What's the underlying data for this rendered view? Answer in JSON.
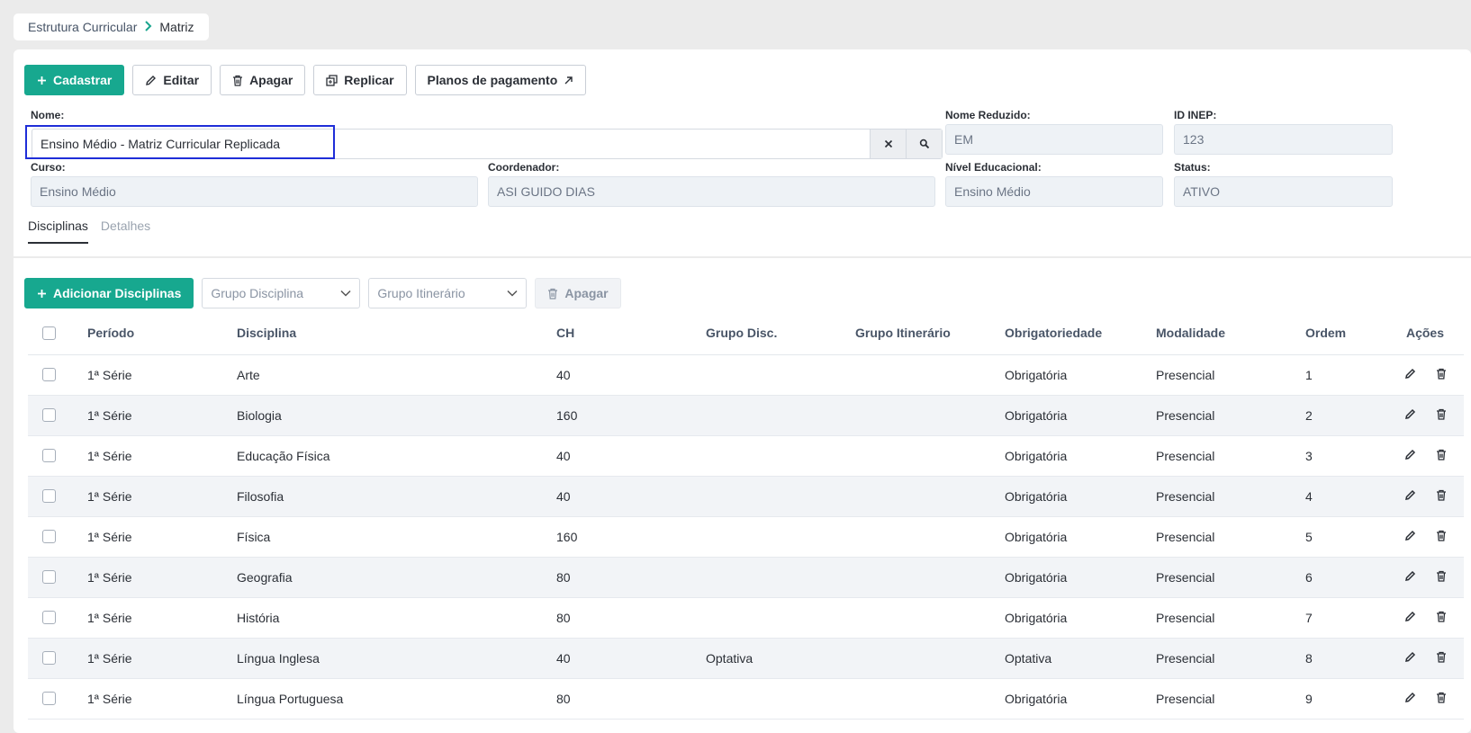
{
  "breadcrumb": {
    "parent": "Estrutura Curricular",
    "separator": ">",
    "current": "Matriz"
  },
  "toolbar": {
    "cadastrar": "Cadastrar",
    "editar": "Editar",
    "apagar": "Apagar",
    "replicar": "Replicar",
    "planos": "Planos de pagamento"
  },
  "form": {
    "nome_label": "Nome:",
    "nome_value": "Ensino Médio - Matriz Curricular Replicada",
    "nome_reduzido_label": "Nome Reduzido:",
    "nome_reduzido_value": "EM",
    "id_inep_label": "ID INEP:",
    "id_inep_value": "123",
    "curso_label": "Curso:",
    "curso_value": "Ensino Médio",
    "coordenador_label": "Coordenador:",
    "coordenador_value": "ASI GUIDO DIAS",
    "nivel_label": "Nível Educacional:",
    "nivel_value": "Ensino Médio",
    "status_label": "Status:",
    "status_value": "ATIVO"
  },
  "tabs": [
    {
      "label": "Disciplinas"
    },
    {
      "label": "Detalhes"
    }
  ],
  "subtoolbar": {
    "adicionar": "Adicionar Disciplinas",
    "grupo_disciplina_placeholder": "Grupo Disciplina",
    "grupo_itinerario_placeholder": "Grupo Itinerário",
    "apagar": "Apagar"
  },
  "table": {
    "headers": [
      "Período",
      "Disciplina",
      "CH",
      "Grupo Disc.",
      "Grupo Itinerário",
      "Obrigatoriedade",
      "Modalidade",
      "Ordem",
      "Ações"
    ],
    "rows": [
      {
        "periodo": "1ª Série",
        "disciplina": "Arte",
        "ch": "40",
        "grupo_disc": "",
        "grupo_itin": "",
        "obrig": "Obrigatória",
        "modal": "Presencial",
        "ordem": "1"
      },
      {
        "periodo": "1ª Série",
        "disciplina": "Biologia",
        "ch": "160",
        "grupo_disc": "",
        "grupo_itin": "",
        "obrig": "Obrigatória",
        "modal": "Presencial",
        "ordem": "2"
      },
      {
        "periodo": "1ª Série",
        "disciplina": "Educação Física",
        "ch": "40",
        "grupo_disc": "",
        "grupo_itin": "",
        "obrig": "Obrigatória",
        "modal": "Presencial",
        "ordem": "3"
      },
      {
        "periodo": "1ª Série",
        "disciplina": "Filosofia",
        "ch": "40",
        "grupo_disc": "",
        "grupo_itin": "",
        "obrig": "Obrigatória",
        "modal": "Presencial",
        "ordem": "4"
      },
      {
        "periodo": "1ª Série",
        "disciplina": "Física",
        "ch": "160",
        "grupo_disc": "",
        "grupo_itin": "",
        "obrig": "Obrigatória",
        "modal": "Presencial",
        "ordem": "5"
      },
      {
        "periodo": "1ª Série",
        "disciplina": "Geografia",
        "ch": "80",
        "grupo_disc": "",
        "grupo_itin": "",
        "obrig": "Obrigatória",
        "modal": "Presencial",
        "ordem": "6"
      },
      {
        "periodo": "1ª Série",
        "disciplina": "História",
        "ch": "80",
        "grupo_disc": "",
        "grupo_itin": "",
        "obrig": "Obrigatória",
        "modal": "Presencial",
        "ordem": "7"
      },
      {
        "periodo": "1ª Série",
        "disciplina": "Língua Inglesa",
        "ch": "40",
        "grupo_disc": "Optativa",
        "grupo_itin": "",
        "obrig": "Optativa",
        "modal": "Presencial",
        "ordem": "8"
      },
      {
        "periodo": "1ª Série",
        "disciplina": "Língua Portuguesa",
        "ch": "80",
        "grupo_disc": "",
        "grupo_itin": "",
        "obrig": "Obrigatória",
        "modal": "Presencial",
        "ordem": "9"
      }
    ]
  },
  "colors": {
    "accent": "#17a88f",
    "highlight": "#1f2ed8"
  }
}
